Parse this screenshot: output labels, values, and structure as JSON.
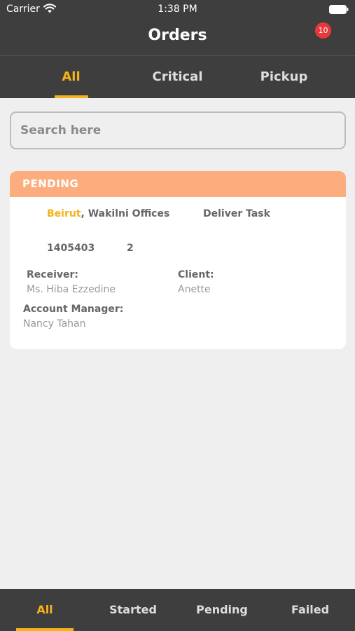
{
  "status_bar": {
    "carrier": "Carrier",
    "time": "1:38 PM",
    "wifi_icon": "wifi-icon",
    "battery_icon": "battery-icon"
  },
  "header": {
    "title": "Orders",
    "notification_count": "10",
    "notification_color": "#e8383d"
  },
  "top_tabs": [
    {
      "label": "All",
      "active": true
    },
    {
      "label": "Critical",
      "active": false
    },
    {
      "label": "Pickup",
      "active": false
    }
  ],
  "search": {
    "placeholder": "Search here",
    "value": ""
  },
  "orders": [
    {
      "status": "PENDING",
      "status_color": "#fcac7d",
      "city": "Beirut",
      "location": ", Wakilni Offices",
      "task_type": "Deliver Task",
      "order_id": "1405403",
      "count": "2",
      "receiver_label": "Receiver:",
      "receiver": "Ms. Hiba Ezzedine",
      "client_label": "Client:",
      "client": "Anette",
      "account_manager_label": "Account Manager:",
      "account_manager": "Nancy Tahan"
    }
  ],
  "bottom_tabs": [
    {
      "label": "All",
      "active": true
    },
    {
      "label": "Started",
      "active": false
    },
    {
      "label": "Pending",
      "active": false
    },
    {
      "label": "Failed",
      "active": false
    }
  ],
  "colors": {
    "accent": "#f6b21b",
    "bar_background": "#3e3e3e",
    "page_background": "#efefef"
  }
}
